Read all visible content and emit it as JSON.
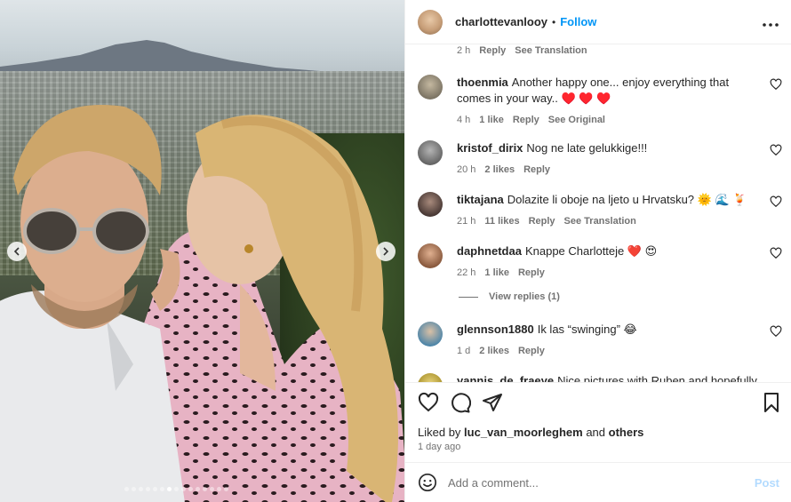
{
  "header": {
    "username": "charlottevanlooy",
    "separator": "•",
    "follow_label": "Follow",
    "more_icon": "more-options-icon"
  },
  "photo": {
    "prev_icon": "chevron-left-icon",
    "next_icon": "chevron-right-icon",
    "carousel_count": 15,
    "carousel_active": 6
  },
  "comments": {
    "partial_top": {
      "time": "2 h",
      "reply": "Reply",
      "translate": "See Translation"
    },
    "items": [
      {
        "user": "thoenmia",
        "text": "Another happy one... enjoy everything that comes in your way.. ♥️ ♥️ ♥️",
        "time": "4 h",
        "likes": "1 like",
        "reply": "Reply",
        "extra": "See Original"
      },
      {
        "user": "kristof_dirix",
        "text": "Nog ne late gelukkige!!!",
        "time": "20 h",
        "likes": "2 likes",
        "reply": "Reply",
        "extra": ""
      },
      {
        "user": "tiktajana",
        "text": "Dolazite li oboje na ljeto u Hrvatsku? 🌞 🌊 🍹",
        "time": "21 h",
        "likes": "11 likes",
        "reply": "Reply",
        "extra": "See Translation"
      },
      {
        "user": "daphnetdaa",
        "text": "Knappe Charlotteje ❤️ 😍",
        "time": "22 h",
        "likes": "1 like",
        "reply": "Reply",
        "extra": ""
      },
      {
        "user": "glennson1880",
        "text": "Ik las “swinging” 😂",
        "time": "1 d",
        "likes": "2 likes",
        "reply": "Reply",
        "extra": ""
      },
      {
        "user": "yannis_de_fraeye",
        "text": "Nice pictures with Ruben and hopefully",
        "time": "",
        "likes": "",
        "reply": "",
        "extra": ""
      }
    ],
    "view_replies": "View replies (1)"
  },
  "actions": {
    "liked_prefix": "Liked by",
    "liked_user": "luc_van_moorleghem",
    "liked_and": "and",
    "liked_others": "others",
    "time_ago": "1 day ago"
  },
  "add_comment": {
    "placeholder": "Add a comment...",
    "post_label": "Post"
  },
  "colors": {
    "accent": "#0095f6",
    "post_disabled": "#b3dbff",
    "muted_text": "#737373"
  }
}
